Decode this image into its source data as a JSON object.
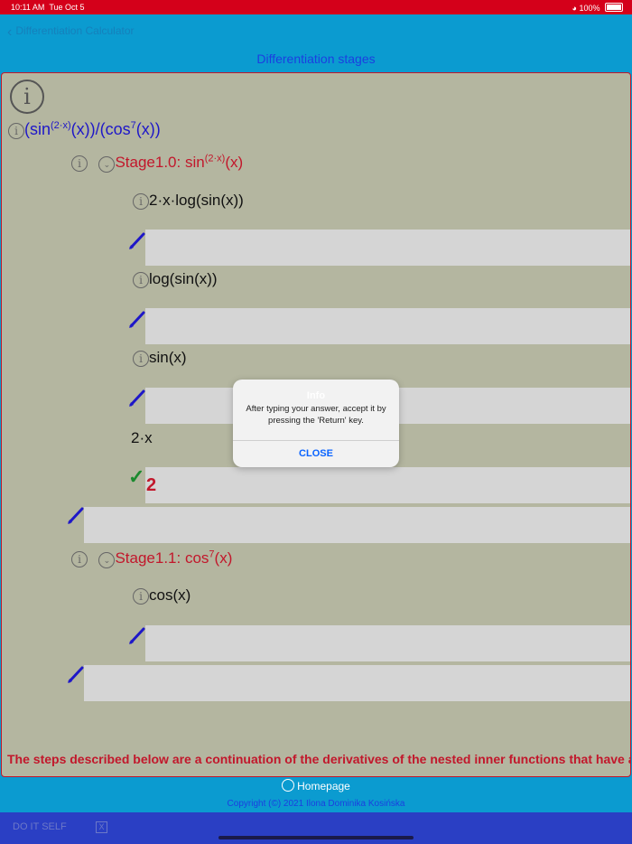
{
  "status": {
    "time": "10:11 AM",
    "date": "Tue Oct 5",
    "wifi_icon": "wifi-icon",
    "battery": "100%"
  },
  "nav": {
    "back_label": "Differentiation Calculator",
    "title": "Differentiation stages"
  },
  "root_expr": {
    "base": "(sin",
    "exp": "(2·x)",
    "mid": "(x))/(cos",
    "exp2": "7",
    "end": "(x))"
  },
  "stage10": {
    "label": "Stage1.0: sin",
    "exp": "(2·x)",
    "end": "(x)"
  },
  "steps": [
    {
      "text": "2·x·log(sin(x))"
    },
    {
      "text": "log(sin(x))"
    },
    {
      "text": "sin(x)"
    },
    {
      "text": "2·x"
    }
  ],
  "answer": "2",
  "stage11": {
    "label": "Stage1.1: cos",
    "exp": "7",
    "end": "(x)"
  },
  "step_cos": "cos(x)",
  "note": "The steps described below are a continuation of the derivatives of the nested inner functions that have alrea",
  "homepage": "Homepage",
  "copyright": "Copyright (©) 2021 Ilona Dominika Kosińska",
  "bottom": {
    "do_it_self": "DO IT SELF",
    "x_label": "X"
  },
  "alert": {
    "title": "Info",
    "message": "After typing your answer, accept it by pressing the 'Return' key.",
    "close": "CLOSE"
  },
  "colors": {
    "accent": "#0b9bd0",
    "panel": "#b4b6a0",
    "red": "#c2172b",
    "blue": "#1e17c8"
  }
}
